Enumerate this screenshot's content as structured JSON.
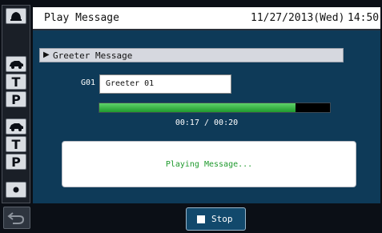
{
  "header": {
    "title": "Play Message",
    "date": "11/27/2013(Wed)",
    "time": "14:50"
  },
  "section": {
    "label": "Greeter Message"
  },
  "message": {
    "code": "G01",
    "name": "Greeter 01"
  },
  "playback": {
    "progress_fraction": 0.85,
    "elapsed": "00:17 / 00:20",
    "status": "Playing Message..."
  },
  "sidebar": {
    "items": [
      {
        "icon": "bell-icon"
      },
      {
        "icon": "car-icon"
      },
      {
        "label": "T"
      },
      {
        "label": "P"
      },
      {
        "icon": "car-icon"
      },
      {
        "label": "T"
      },
      {
        "label": "P"
      },
      {
        "icon": "dot-icon"
      }
    ]
  },
  "footer": {
    "stop_label": "Stop",
    "back_icon": "back-arrow-icon"
  },
  "colors": {
    "panel": "#0e3a58",
    "progress_fill": "#2fb83a",
    "status_text": "#1f9a2d",
    "stop_button": "#12496c"
  }
}
